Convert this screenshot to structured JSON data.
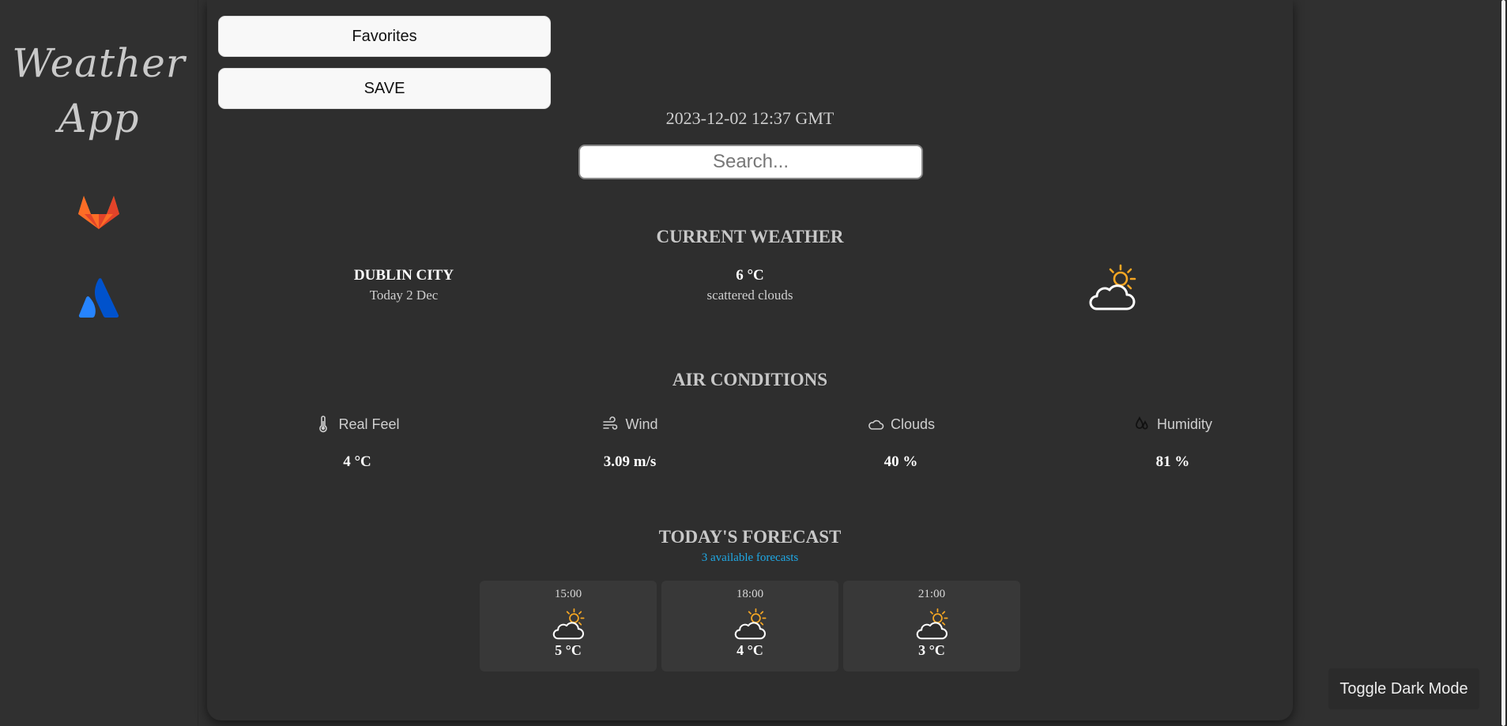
{
  "sidebar": {
    "app_title_line1": "Weather",
    "app_title_line2": "App",
    "icons": [
      "gitlab-icon",
      "atlassian-icon"
    ]
  },
  "header": {
    "favorites_label": "Favorites",
    "save_label": "SAVE",
    "datetime": "2023-12-02 12:37 GMT",
    "search_placeholder": "Search..."
  },
  "current": {
    "title": "CURRENT WEATHER",
    "city": "DUBLIN CITY",
    "date": "Today 2 Dec",
    "temp": "6 °C",
    "description": "scattered clouds",
    "icon": "partly-cloudy-icon"
  },
  "air": {
    "title": "AIR CONDITIONS",
    "items": [
      {
        "label": "Real Feel",
        "value": "4 °C",
        "icon": "thermometer-icon"
      },
      {
        "label": "Wind",
        "value": "3.09 m/s",
        "icon": "wind-icon"
      },
      {
        "label": "Clouds",
        "value": "40 %",
        "icon": "cloud-icon"
      },
      {
        "label": "Humidity",
        "value": "81 %",
        "icon": "humidity-icon"
      }
    ]
  },
  "forecast": {
    "title": "TODAY'S FORECAST",
    "subtitle": "3 available forecasts",
    "items": [
      {
        "time": "15:00",
        "temp": "5 °C",
        "icon": "partly-cloudy-icon"
      },
      {
        "time": "18:00",
        "temp": "4 °C",
        "icon": "partly-cloudy-icon"
      },
      {
        "time": "21:00",
        "temp": "3 °C",
        "icon": "partly-cloudy-icon"
      }
    ]
  },
  "toggle_label": "Toggle Dark Mode",
  "colors": {
    "background": "#303030",
    "panel": "#2e2e2e",
    "accent": "#1fa9e6",
    "sun": "#f5a623"
  }
}
